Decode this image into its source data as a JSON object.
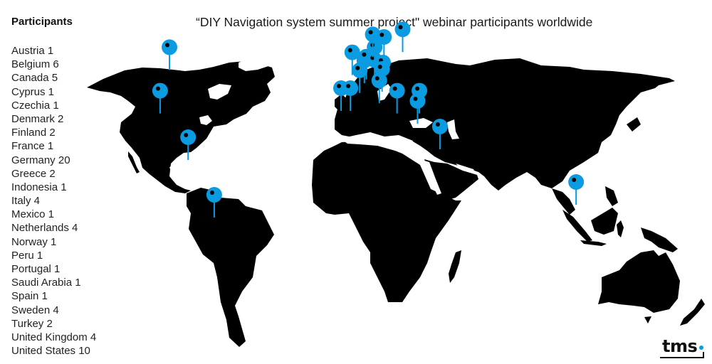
{
  "title": "“DIY Navigation system summer project\" webinar participants worldwide",
  "legend": {
    "title": "Participants",
    "items": [
      {
        "country": "Austria",
        "count": 1,
        "label": "Austria 1"
      },
      {
        "country": "Belgium",
        "count": 6,
        "label": "Belgium 6"
      },
      {
        "country": "Canada",
        "count": 5,
        "label": "Canada 5"
      },
      {
        "country": "Cyprus",
        "count": 1,
        "label": "Cyprus 1"
      },
      {
        "country": "Czechia",
        "count": 1,
        "label": "Czechia 1"
      },
      {
        "country": "Denmark",
        "count": 2,
        "label": "Denmark 2"
      },
      {
        "country": "Finland",
        "count": 2,
        "label": "Finland 2"
      },
      {
        "country": "France",
        "count": 1,
        "label": "France 1"
      },
      {
        "country": "Germany",
        "count": 20,
        "label": "Germany 20"
      },
      {
        "country": "Greece",
        "count": 2,
        "label": "Greece 2"
      },
      {
        "country": "Indonesia",
        "count": 1,
        "label": "Indonesia 1"
      },
      {
        "country": "Italy",
        "count": 4,
        "label": "Italy 4"
      },
      {
        "country": "Mexico",
        "count": 1,
        "label": "Mexico 1"
      },
      {
        "country": "Netherlands",
        "count": 4,
        "label": "Netherlands 4"
      },
      {
        "country": "Norway",
        "count": 1,
        "label": "Norway 1"
      },
      {
        "country": "Peru",
        "count": 1,
        "label": "Peru 1"
      },
      {
        "country": "Portugal",
        "count": 1,
        "label": "Portugal 1"
      },
      {
        "country": "Saudi Arabia",
        "count": 1,
        "label": "Saudi Arabia 1"
      },
      {
        "country": "Spain",
        "count": 1,
        "label": "Spain 1"
      },
      {
        "country": "Sweden",
        "count": 4,
        "label": "Sweden 4"
      },
      {
        "country": "Turkey",
        "count": 2,
        "label": "Turkey 2"
      },
      {
        "country": "United Kingdom",
        "count": 4,
        "label": "United Kingdom 4"
      },
      {
        "country": "United States",
        "count": 10,
        "label": "United States 10"
      }
    ]
  },
  "map": {
    "land_color": "#000000",
    "pin_color": "#0a9be0",
    "pins": [
      {
        "country": "Canada",
        "lat": 56,
        "lon": -100
      },
      {
        "country": "United States",
        "lat": 39,
        "lon": -105
      },
      {
        "country": "Mexico",
        "lat": 19,
        "lon": -90
      },
      {
        "country": "Peru",
        "lat": -8,
        "lon": -76
      },
      {
        "country": "Portugal",
        "lat": 40,
        "lon": -8
      },
      {
        "country": "Spain",
        "lat": 40,
        "lon": -3
      },
      {
        "country": "France",
        "lat": 47,
        "lon": 2
      },
      {
        "country": "United Kingdom",
        "lat": 54,
        "lon": -2
      },
      {
        "country": "Belgium",
        "lat": 50.8,
        "lon": 4.5
      },
      {
        "country": "Netherlands",
        "lat": 52.3,
        "lon": 5.5
      },
      {
        "country": "Germany",
        "lat": 51,
        "lon": 10
      },
      {
        "country": "Denmark",
        "lat": 56,
        "lon": 10
      },
      {
        "country": "Czechia",
        "lat": 50,
        "lon": 14.5
      },
      {
        "country": "Austria",
        "lat": 47.5,
        "lon": 14
      },
      {
        "country": "Norway",
        "lat": 61,
        "lon": 9
      },
      {
        "country": "Sweden",
        "lat": 60,
        "lon": 15
      },
      {
        "country": "Finland",
        "lat": 63,
        "lon": 25
      },
      {
        "country": "Italy",
        "lat": 43,
        "lon": 12.5
      },
      {
        "country": "Greece",
        "lat": 39,
        "lon": 22
      },
      {
        "country": "Turkey",
        "lat": 39,
        "lon": 34
      },
      {
        "country": "Cyprus",
        "lat": 35,
        "lon": 33
      },
      {
        "country": "Saudi Arabia",
        "lat": 24,
        "lon": 45
      },
      {
        "country": "Indonesia",
        "lat": -2,
        "lon": 118
      }
    ]
  },
  "logo": {
    "text": "tms",
    "accent": "#0a9be0"
  }
}
